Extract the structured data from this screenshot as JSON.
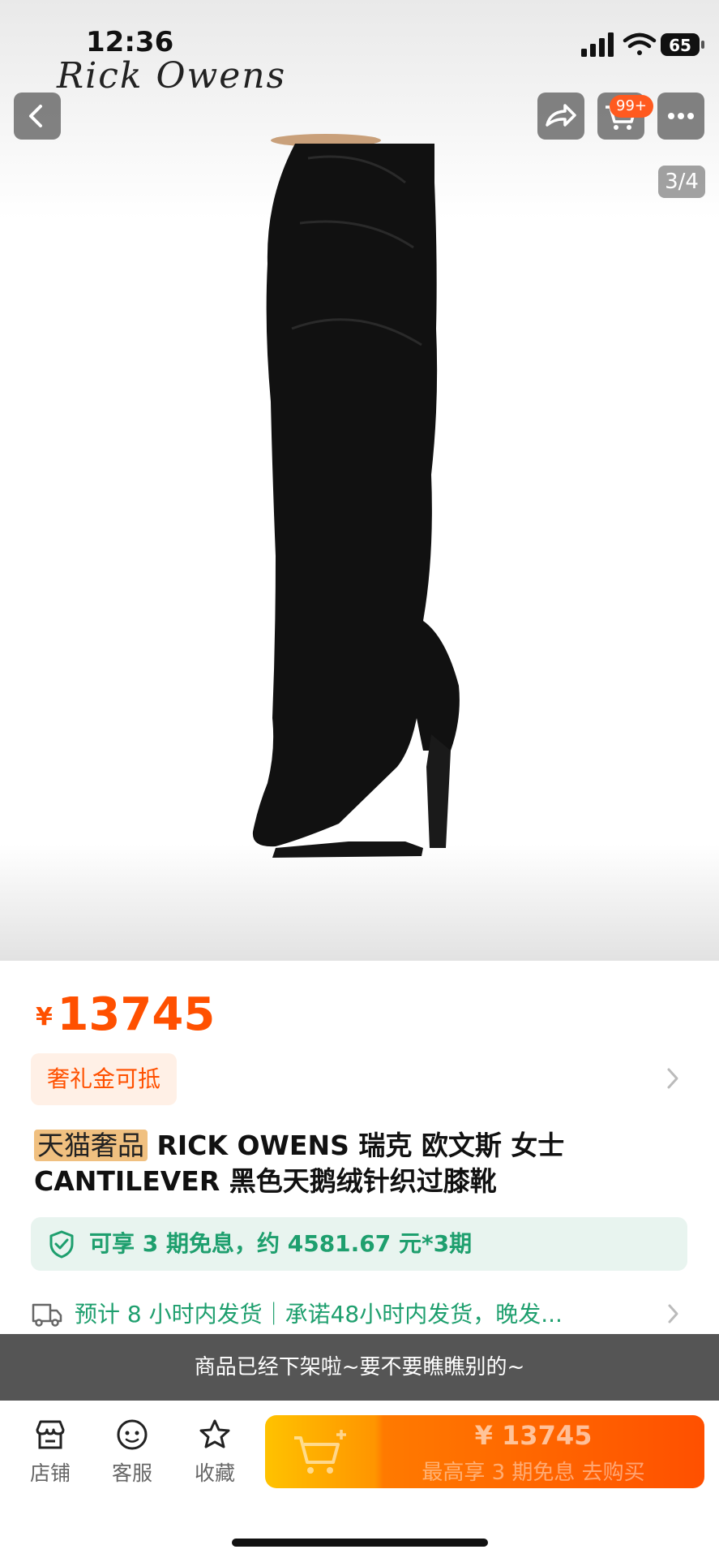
{
  "status_bar": {
    "time": "12:36",
    "battery": "65"
  },
  "brand": {
    "logo_text": "Rick Owens"
  },
  "header": {
    "cart_badge": "99+",
    "page_indicator": "3/4"
  },
  "product": {
    "currency": "¥",
    "price": "13745",
    "promo_tag": "奢礼金可抵",
    "title_badge": "天猫奢品",
    "title": " RICK OWENS 瑞克 欧文斯 女士 CANTILEVER 黑色天鹅绒针织过膝靴",
    "installment": "可享 3 期免息，约 4581.67 元*3期",
    "shipping": "预计 8 小时内发货｜承诺48小时内发货，晚发..."
  },
  "toast": "商品已经下架啦~要不要瞧瞧别的~",
  "bottom_bar": {
    "store": "店铺",
    "service": "客服",
    "favorite": "收藏",
    "buy_price": "¥ 13745",
    "buy_sub": "最高享 3 期免息   去购买"
  },
  "colors": {
    "accent": "#ff5000",
    "green": "#1e9f6e",
    "toast_bg": "#555555"
  }
}
